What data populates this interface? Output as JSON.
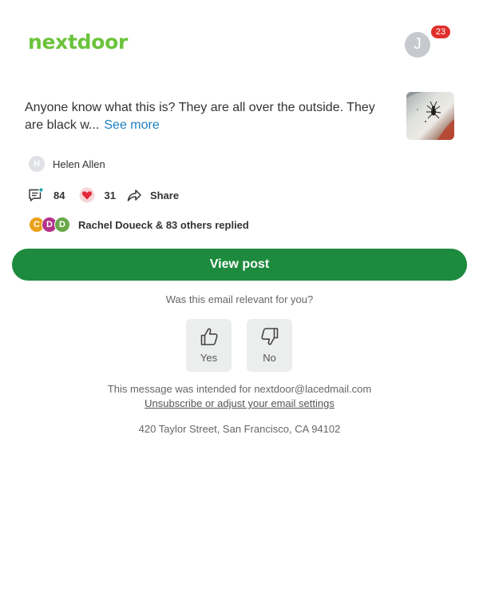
{
  "header": {
    "logo": "nextdoor",
    "brand_color": "#6bc33b",
    "user_initial": "J",
    "notification_count": "23"
  },
  "post": {
    "text": "Anyone know what this is? They are all over the outside. They are black w...",
    "see_more_label": "See more",
    "image_icon": "insect-photo",
    "author": {
      "initial": "H",
      "name": "Helen Allen"
    },
    "comment_count": "84",
    "reaction_count": "31",
    "share_label": "Share",
    "repliers": [
      {
        "initial": "C",
        "color": "#e9a01a"
      },
      {
        "initial": "D",
        "color": "#b3338a"
      },
      {
        "initial": "D",
        "color": "#6aa84a"
      }
    ],
    "replies_text": "Rachel Doueck & 83 others replied"
  },
  "cta": {
    "view_post_label": "View post",
    "button_color": "#1d8a3e"
  },
  "feedback": {
    "question": "Was this email relevant for you?",
    "yes_label": "Yes",
    "no_label": "No"
  },
  "footer": {
    "intended": "This message was intended for nextdoor@lacedmail.com",
    "unsubscribe_label": "Unsubscribe or adjust your email settings",
    "address": "420 Taylor Street, San Francisco, CA 94102"
  }
}
